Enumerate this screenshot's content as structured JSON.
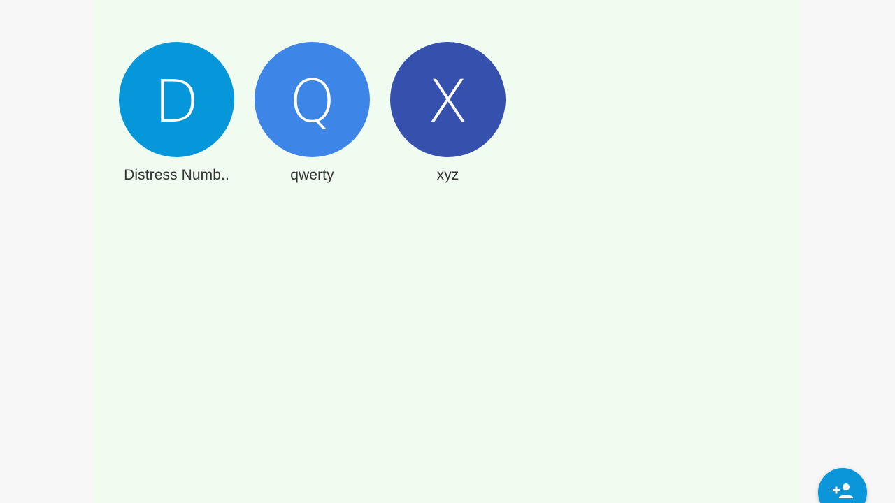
{
  "contacts": [
    {
      "initial": "D",
      "name": "Distress Numb..",
      "color": "#0597d9"
    },
    {
      "initial": "Q",
      "name": "qwerty",
      "color": "#3d86e8"
    },
    {
      "initial": "X",
      "name": "xyz",
      "color": "#3550ad"
    }
  ],
  "fab": {
    "icon": "add-person-icon",
    "color": "#0a96d8"
  },
  "colors": {
    "background": "#f7f7f7",
    "panel": "#f1fcf0",
    "text": "#333333"
  }
}
